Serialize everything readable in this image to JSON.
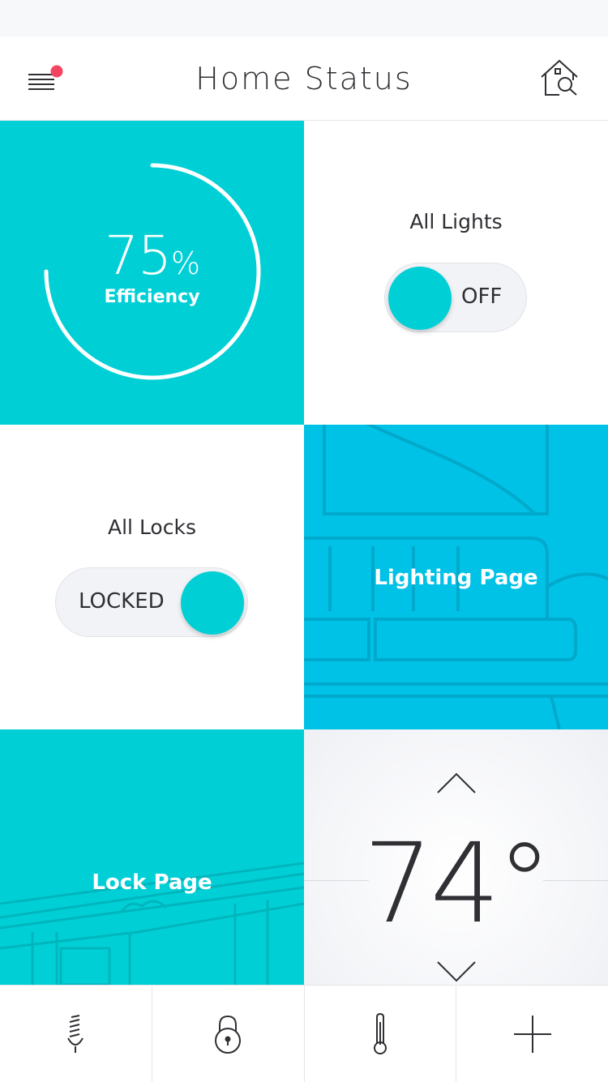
{
  "header": {
    "title": "Home Status",
    "menu_icon": "hamburger-menu-icon",
    "notification_dot_color": "#f44560",
    "right_icon": "home-search-icon"
  },
  "efficiency": {
    "value": "75",
    "unit": "%",
    "label": "Efficiency",
    "progress": 0.75
  },
  "lights": {
    "title": "All Lights",
    "state": "OFF"
  },
  "locks": {
    "title": "All Locks",
    "state": "LOCKED"
  },
  "lighting_page": {
    "label": "Lighting Page"
  },
  "lock_page": {
    "label": "Lock Page"
  },
  "thermostat": {
    "temperature": "74°",
    "up_icon": "chevron-up-icon",
    "down_icon": "chevron-down-icon"
  },
  "tabbar": {
    "tabs": [
      {
        "icon": "light-bulb-icon"
      },
      {
        "icon": "lock-icon"
      },
      {
        "icon": "thermometer-icon"
      },
      {
        "icon": "plus-icon"
      }
    ]
  },
  "colors": {
    "accent": "#00d0d6",
    "lighting_tile": "#00c2e6",
    "text": "#2f2f34",
    "background": "#f7f8fa"
  }
}
